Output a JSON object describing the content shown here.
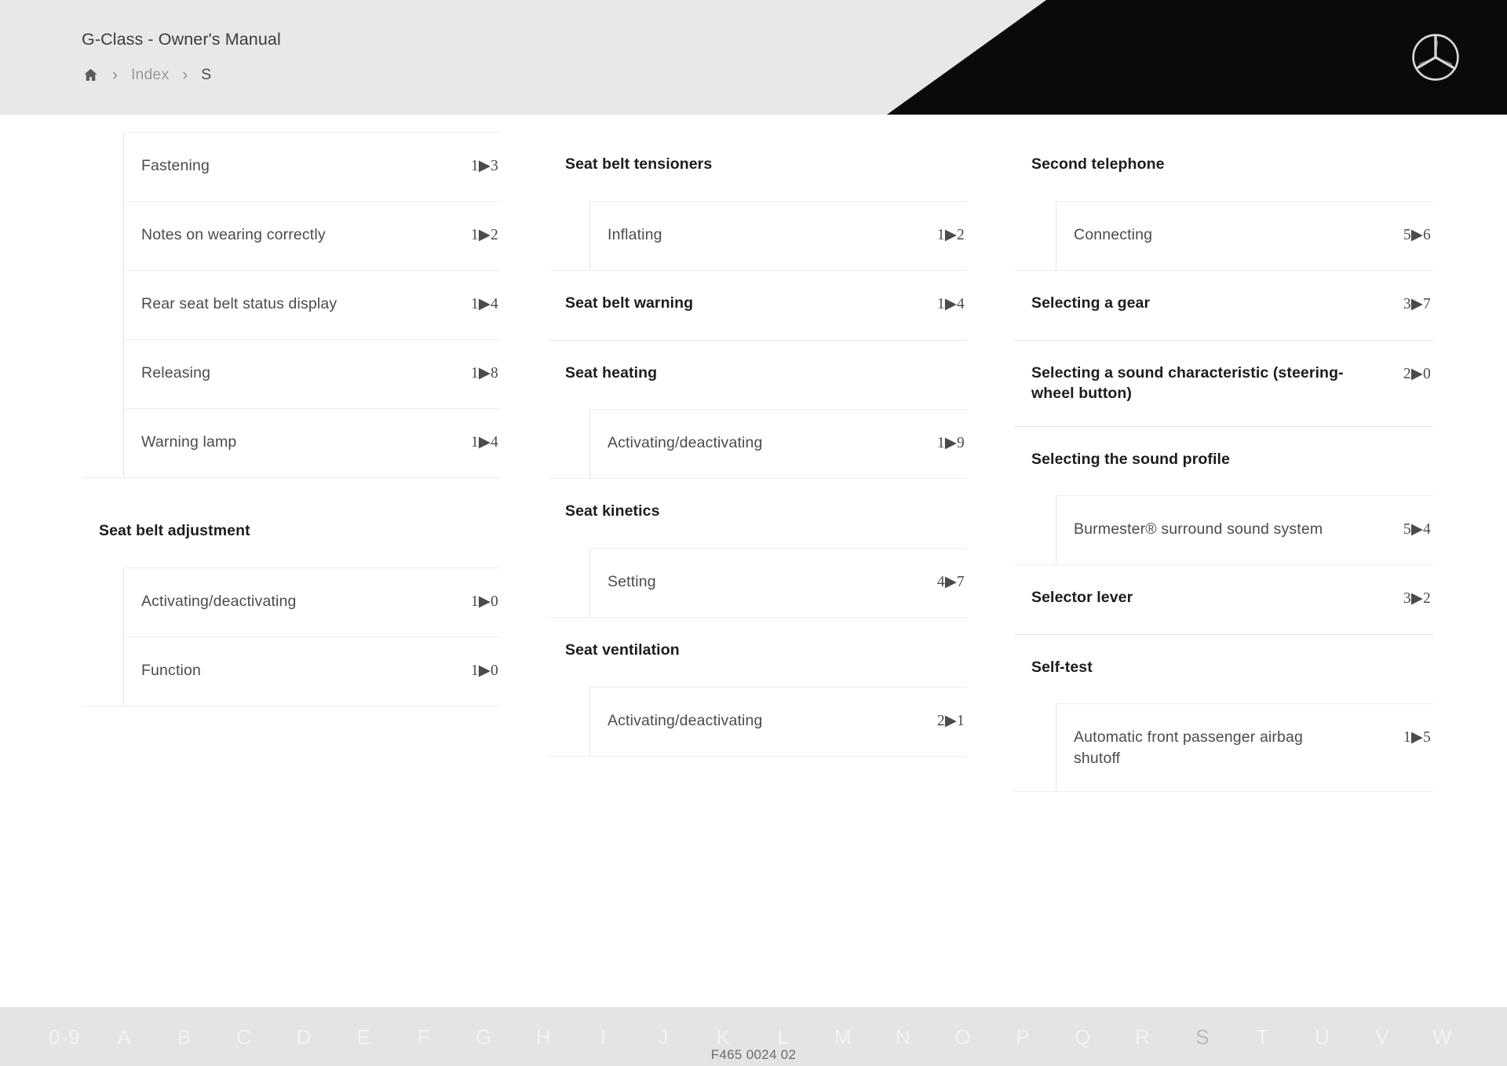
{
  "header": {
    "title": "G-Class - Owner's Manual",
    "breadcrumb": {
      "home_icon": "home-icon",
      "separator": "›",
      "index_label": "Index",
      "current_label": "S"
    },
    "brand_logo": "mercedes-benz-star-icon"
  },
  "index": {
    "columns": [
      {
        "groups": [
          {
            "subs": [
              {
                "label": "Fastening",
                "page": "1▶3"
              },
              {
                "label": "Notes on wearing correctly",
                "page": "1▶2"
              },
              {
                "label": "Rear seat belt status display",
                "page": "1▶4"
              },
              {
                "label": "Releasing",
                "page": "1▶8"
              },
              {
                "label": "Warning lamp",
                "page": "1▶4"
              }
            ]
          },
          {
            "heading": "Seat belt adjustment",
            "heading_page": "",
            "subs": [
              {
                "label": "Activating/deactivating",
                "page": "1▶0"
              },
              {
                "label": "Function",
                "page": "1▶0"
              }
            ]
          }
        ]
      },
      {
        "groups": [
          {
            "heading": "Seat belt tensioners",
            "heading_page": "",
            "subs": [
              {
                "label": "Inflating",
                "page": "1▶2"
              }
            ]
          },
          {
            "heading": "Seat belt warning",
            "heading_page": "1▶4",
            "subs": []
          },
          {
            "heading": "Seat heating",
            "heading_page": "",
            "subs": [
              {
                "label": "Activating/deactivating",
                "page": "1▶9"
              }
            ]
          },
          {
            "heading": "Seat kinetics",
            "heading_page": "",
            "subs": [
              {
                "label": "Setting",
                "page": "4▶7"
              }
            ]
          },
          {
            "heading": "Seat ventilation",
            "heading_page": "",
            "subs": [
              {
                "label": "Activating/deactivating",
                "page": "2▶1"
              }
            ]
          }
        ]
      },
      {
        "groups": [
          {
            "heading": "Second telephone",
            "heading_page": "",
            "subs": [
              {
                "label": "Connecting",
                "page": "5▶6"
              }
            ]
          },
          {
            "heading": "Selecting a gear",
            "heading_page": "3▶7",
            "subs": []
          },
          {
            "heading": "Selecting a sound characteristic (steering-wheel button)",
            "heading_page": "2▶0",
            "subs": []
          },
          {
            "heading": "Selecting the sound profile",
            "heading_page": "",
            "subs": [
              {
                "label": "Burmester® surround sound system",
                "page": "5▶4"
              }
            ]
          },
          {
            "heading": "Selector lever",
            "heading_page": "3▶2",
            "subs": []
          },
          {
            "heading": "Self-test",
            "heading_page": "",
            "subs": [
              {
                "label": "Automatic front passenger airbag shutoff",
                "page": "1▶5"
              }
            ]
          }
        ]
      }
    ]
  },
  "alphabet": {
    "active": "S",
    "letters": [
      "0-9",
      "A",
      "B",
      "C",
      "D",
      "E",
      "F",
      "G",
      "H",
      "I",
      "J",
      "K",
      "L",
      "M",
      "N",
      "O",
      "P",
      "Q",
      "R",
      "S",
      "T",
      "U",
      "V",
      "W"
    ]
  },
  "footer": {
    "document_code": "F465 0024 02"
  }
}
